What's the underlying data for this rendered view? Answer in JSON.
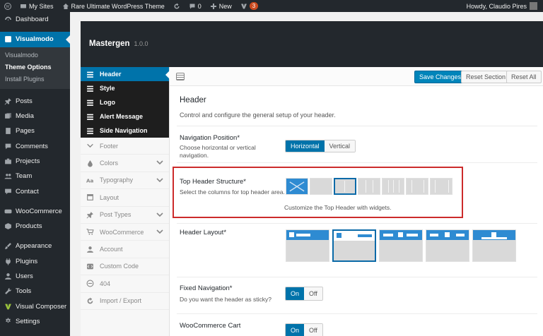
{
  "adminbar": {
    "my_sites": "My Sites",
    "site_name": "Rare Ultimate WordPress Theme",
    "comments_count": "0",
    "new_label": "New",
    "updates_count": "3",
    "howdy": "Howdy, Claudio Pires"
  },
  "wpmenu": {
    "dashboard": "Dashboard",
    "visualmodo": "Visualmodo",
    "sub": [
      "Visualmodo",
      "Theme Options",
      "Install Plugins"
    ],
    "items": [
      "Posts",
      "Media",
      "Pages",
      "Comments",
      "Projects",
      "Team",
      "Contact"
    ],
    "items2": [
      "WooCommerce",
      "Products"
    ],
    "items3": [
      "Appearance",
      "Plugins",
      "Users",
      "Tools",
      "Visual Composer",
      "Settings"
    ]
  },
  "panel": {
    "title": "Mastergen",
    "version": "1.0.0"
  },
  "vmnav": {
    "dark": [
      "Header",
      "Style",
      "Logo",
      "Alert Message",
      "Side Navigation"
    ],
    "light": [
      "Footer",
      "Colors",
      "Typography",
      "Layout",
      "Post Types",
      "WooCommerce",
      "Account",
      "Custom Code",
      "404",
      "Import / Export"
    ]
  },
  "toolbar": {
    "save": "Save Changes",
    "reset_section": "Reset Section",
    "reset_all": "Reset All"
  },
  "section": {
    "title": "Header",
    "desc": "Control and configure the general setup of your header.",
    "nav_position": {
      "label": "Navigation Position*",
      "desc": "Choose horizontal or vertical navigation.",
      "options": [
        "Horizontal",
        "Vertical"
      ],
      "selected": "Horizontal"
    },
    "top_header": {
      "label": "Top Header Structure*",
      "desc": "Select the columns for top header area.",
      "note": "Customize the Top Header with widgets."
    },
    "header_layout": {
      "label": "Header Layout*"
    },
    "fixed_nav": {
      "label": "Fixed Navigation*",
      "desc": "Do you want the header as sticky?",
      "on": "On",
      "off": "Off"
    },
    "woo_cart": {
      "label": "WooCommerce Cart",
      "on": "On",
      "off": "Off"
    }
  },
  "colors": {
    "wp_blue": "#0073aa",
    "highlight_red": "#cc2b2b",
    "tile_blue": "#2e8bd2"
  }
}
